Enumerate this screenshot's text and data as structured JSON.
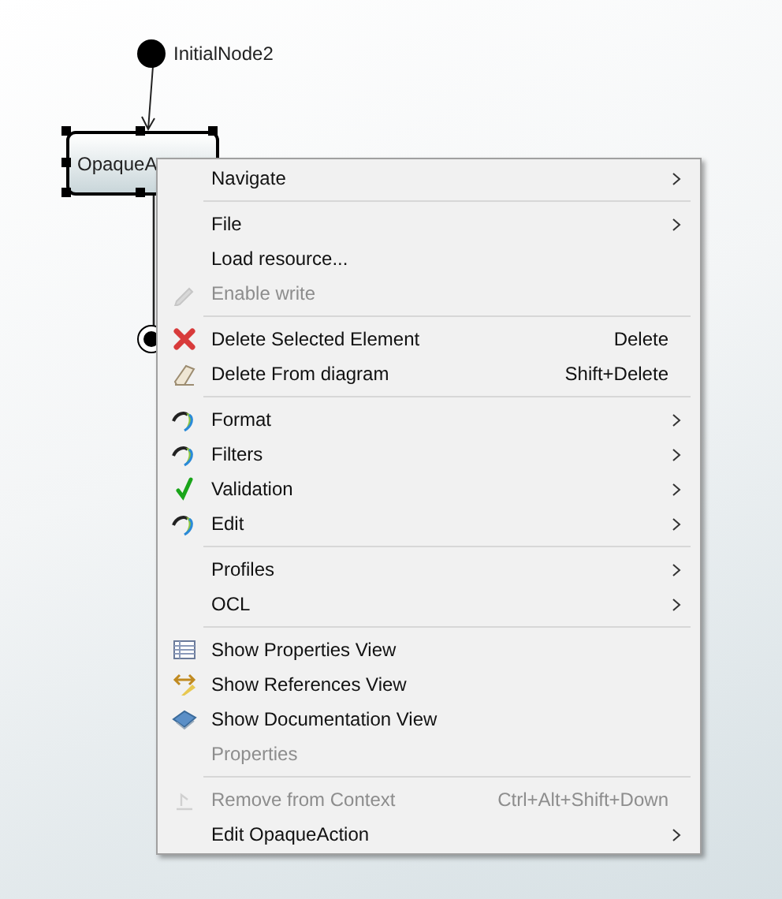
{
  "diagram": {
    "initial_node": {
      "label": "InitialNode2"
    },
    "action": {
      "label": "OpaqueA",
      "selected": true
    }
  },
  "context_menu": {
    "groups": [
      [
        {
          "label": "Navigate",
          "submenu": true,
          "disabled": false
        }
      ],
      [
        {
          "label": "File",
          "submenu": true,
          "disabled": false
        },
        {
          "label": "Load resource...",
          "submenu": false,
          "disabled": false
        },
        {
          "label": "Enable write",
          "kind": "pencil",
          "submenu": false,
          "disabled": true
        }
      ],
      [
        {
          "label": "Delete Selected Element",
          "kind": "delete",
          "shortcut": "Delete",
          "submenu": false,
          "disabled": false
        },
        {
          "label": "Delete From diagram",
          "kind": "eraser",
          "shortcut": "Shift+Delete",
          "submenu": false,
          "disabled": false
        }
      ],
      [
        {
          "label": "Format",
          "kind": "swirl",
          "submenu": true,
          "disabled": false
        },
        {
          "label": "Filters",
          "kind": "swirl",
          "submenu": true,
          "disabled": false
        },
        {
          "label": "Validation",
          "kind": "check",
          "submenu": true,
          "disabled": false
        },
        {
          "label": "Edit",
          "kind": "swirl",
          "submenu": true,
          "disabled": false
        }
      ],
      [
        {
          "label": "Profiles",
          "submenu": true,
          "disabled": false
        },
        {
          "label": "OCL",
          "submenu": true,
          "disabled": false
        }
      ],
      [
        {
          "label": "Show Properties View",
          "kind": "table",
          "submenu": false,
          "disabled": false
        },
        {
          "label": "Show References View",
          "kind": "references",
          "submenu": false,
          "disabled": false
        },
        {
          "label": "Show Documentation View",
          "kind": "book",
          "submenu": false,
          "disabled": false
        },
        {
          "label": "Properties",
          "submenu": false,
          "disabled": true
        }
      ],
      [
        {
          "label": "Remove from Context",
          "kind": "remove",
          "shortcut": "Ctrl+Alt+Shift+Down",
          "submenu": false,
          "disabled": true
        },
        {
          "label": "Edit OpaqueAction",
          "submenu": true,
          "disabled": false
        }
      ]
    ]
  }
}
